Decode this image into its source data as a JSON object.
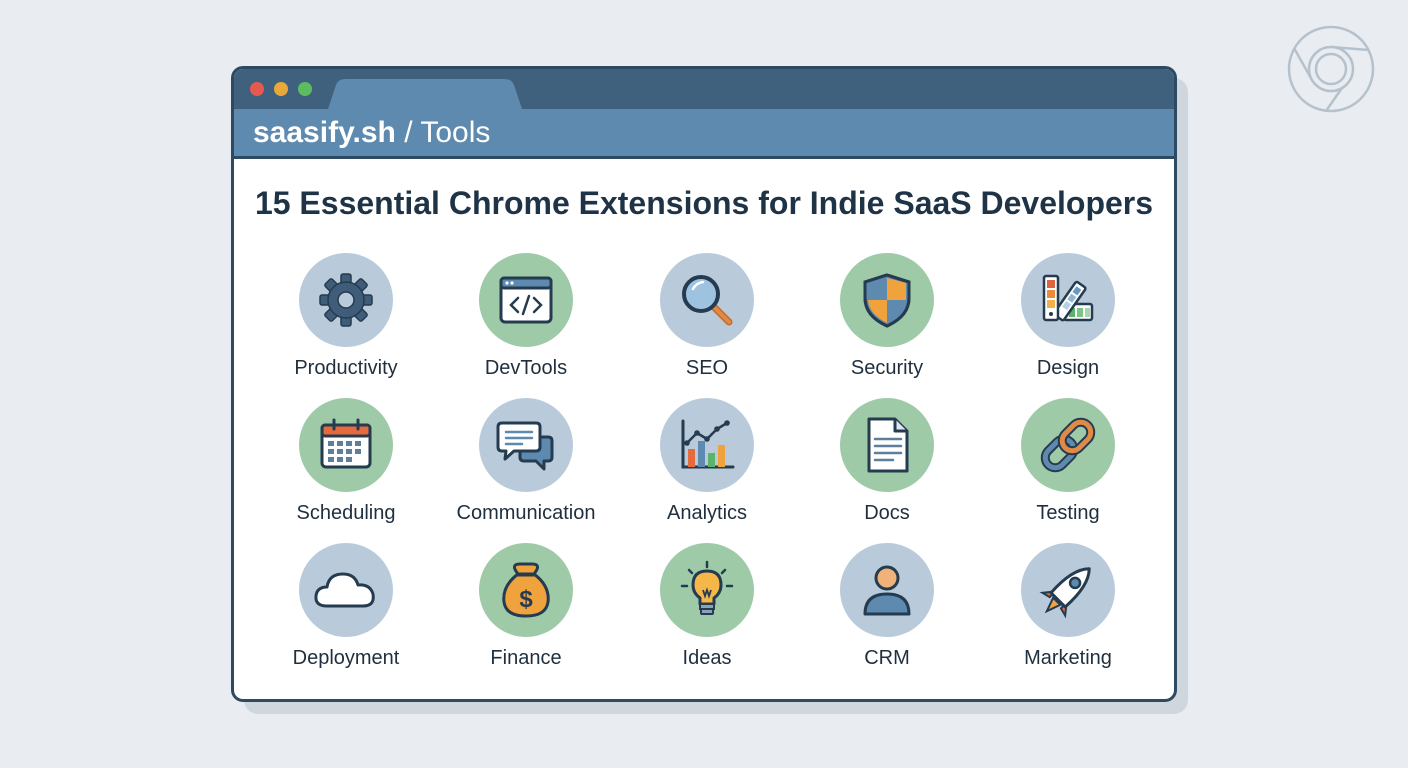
{
  "browser": {
    "logo_icon": "chrome-logo-icon"
  },
  "window": {
    "traffic_lights": [
      "#e5594f",
      "#e9a83a",
      "#5cbc5f"
    ],
    "url": {
      "domain": "saasify.sh",
      "path": "/ Tools"
    }
  },
  "page": {
    "title": "15 Essential Chrome Extensions for Indie SaaS Developers"
  },
  "categories": [
    {
      "label": "Productivity",
      "icon": "gear-icon",
      "bg": "blue"
    },
    {
      "label": "DevTools",
      "icon": "code-window-icon",
      "bg": "green"
    },
    {
      "label": "SEO",
      "icon": "magnifier-icon",
      "bg": "blue"
    },
    {
      "label": "Security",
      "icon": "shield-icon",
      "bg": "green"
    },
    {
      "label": "Design",
      "icon": "color-palette-icon",
      "bg": "blue"
    },
    {
      "label": "Scheduling",
      "icon": "calendar-icon",
      "bg": "green"
    },
    {
      "label": "Communication",
      "icon": "chat-bubbles-icon",
      "bg": "blue"
    },
    {
      "label": "Analytics",
      "icon": "bar-chart-icon",
      "bg": "blue"
    },
    {
      "label": "Docs",
      "icon": "document-icon",
      "bg": "green"
    },
    {
      "label": "Testing",
      "icon": "chain-link-icon",
      "bg": "green"
    },
    {
      "label": "Deployment",
      "icon": "cloud-icon",
      "bg": "blue"
    },
    {
      "label": "Finance",
      "icon": "money-bag-icon",
      "bg": "green"
    },
    {
      "label": "Ideas",
      "icon": "lightbulb-icon",
      "bg": "green"
    },
    {
      "label": "CRM",
      "icon": "person-icon",
      "bg": "blue"
    },
    {
      "label": "Marketing",
      "icon": "rocket-icon",
      "bg": "blue"
    }
  ]
}
